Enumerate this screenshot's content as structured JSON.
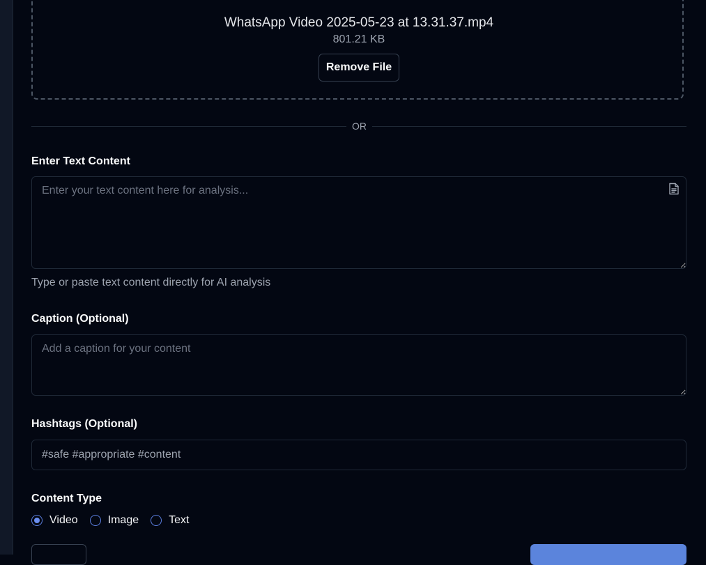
{
  "upload": {
    "file_name": "WhatsApp Video 2025-05-23 at 13.31.37.mp4",
    "file_size": "801.21 KB",
    "remove_label": "Remove File"
  },
  "divider": {
    "text": "OR"
  },
  "text_content": {
    "label": "Enter Text Content",
    "placeholder": "Enter your text content here for analysis...",
    "value": "",
    "help": "Type or paste text content directly for AI analysis",
    "icon": "document-icon"
  },
  "caption": {
    "label": "Caption (Optional)",
    "placeholder": "Add a caption for your content",
    "value": ""
  },
  "hashtags": {
    "label": "Hashtags (Optional)",
    "placeholder": "#safe #appropriate #content",
    "value": ""
  },
  "content_type": {
    "label": "Content Type",
    "selected": "Video",
    "options": [
      "Video",
      "Image",
      "Text"
    ]
  },
  "colors": {
    "background": "#030712",
    "accent": "#5b84dc",
    "border": "#1f2937"
  }
}
